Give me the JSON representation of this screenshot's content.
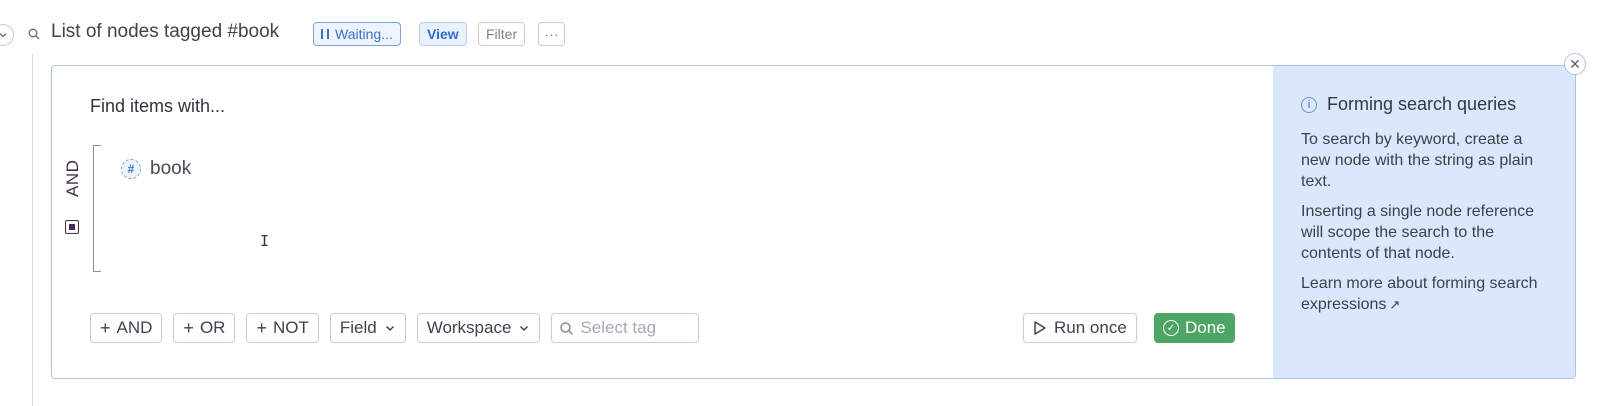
{
  "header": {
    "title": "List of nodes tagged #book",
    "waiting_label": "Waiting...",
    "view_label": "View",
    "filter_label": "Filter",
    "more_label": "···"
  },
  "query": {
    "find_label": "Find items with...",
    "operator": "AND",
    "tag": "book",
    "tag_icon_glyph": "#"
  },
  "toolbar": {
    "and_label": "AND",
    "or_label": "OR",
    "not_label": "NOT",
    "field_label": "Field",
    "workspace_label": "Workspace",
    "select_tag_placeholder": "Select tag",
    "run_once_label": "Run once",
    "done_label": "Done"
  },
  "help": {
    "title": "Forming search queries",
    "p1": "To search by keyword, create a new node with the string as plain text.",
    "p2": "Inserting a single node reference will scope the search to the contents of that node.",
    "p3": "Learn more about forming search expressions"
  },
  "colors": {
    "done_green": "#4fa565",
    "help_bg": "#dbe7fb",
    "accent_blue": "#3a72c4",
    "and_purple": "#4a2b55"
  },
  "icons": [
    "chevron-down-icon",
    "search-icon",
    "pause-icon",
    "close-icon",
    "info-icon",
    "hash-tag-icon",
    "play-icon",
    "check-circle-icon",
    "external-link-icon",
    "plus-icon"
  ]
}
